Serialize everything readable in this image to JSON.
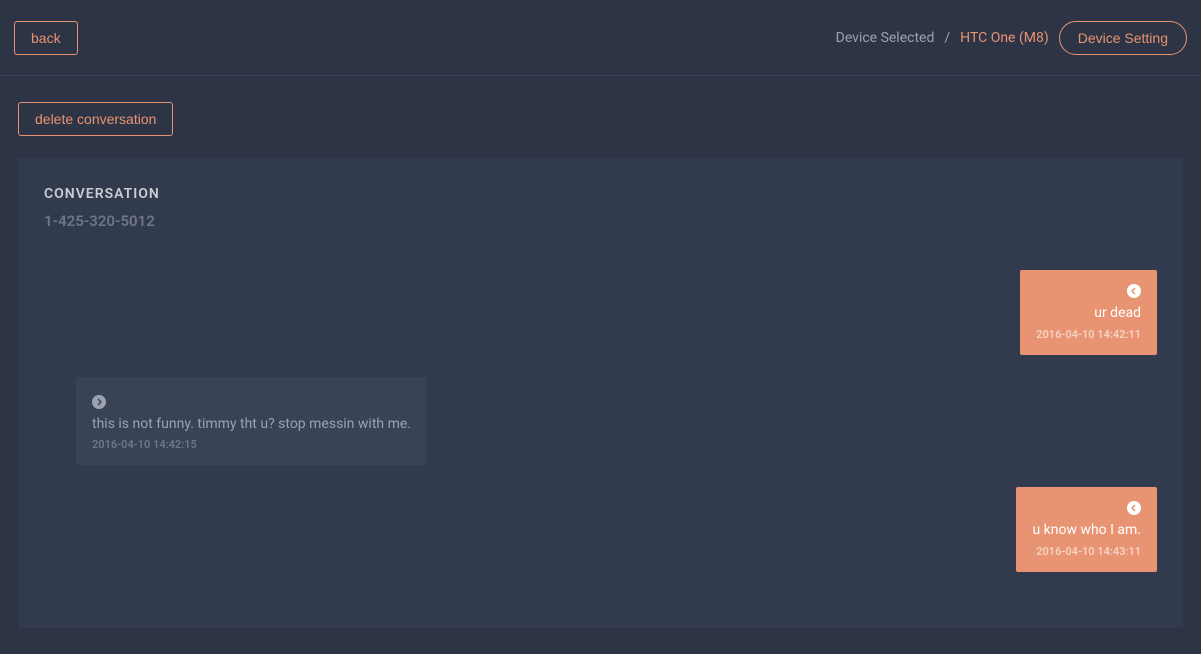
{
  "header": {
    "back_label": "back",
    "device_selected_label": "Device Selected",
    "separator": "/",
    "device_name": "HTC One (M8)",
    "device_setting_label": "Device Setting"
  },
  "actions": {
    "delete_conversation_label": "delete conversation"
  },
  "conversation": {
    "heading": "CONVERSATION",
    "phone_number": "1-425-320-5012"
  },
  "messages": [
    {
      "direction": "outgoing",
      "text": "ur dead",
      "timestamp": "2016-04-10 14:42:11"
    },
    {
      "direction": "incoming",
      "text": "this is not funny. timmy tht u? stop messin with me.",
      "timestamp": "2016-04-10 14:42:15"
    },
    {
      "direction": "outgoing",
      "text": "u know who I am.",
      "timestamp": "2016-04-10 14:43:11"
    }
  ]
}
